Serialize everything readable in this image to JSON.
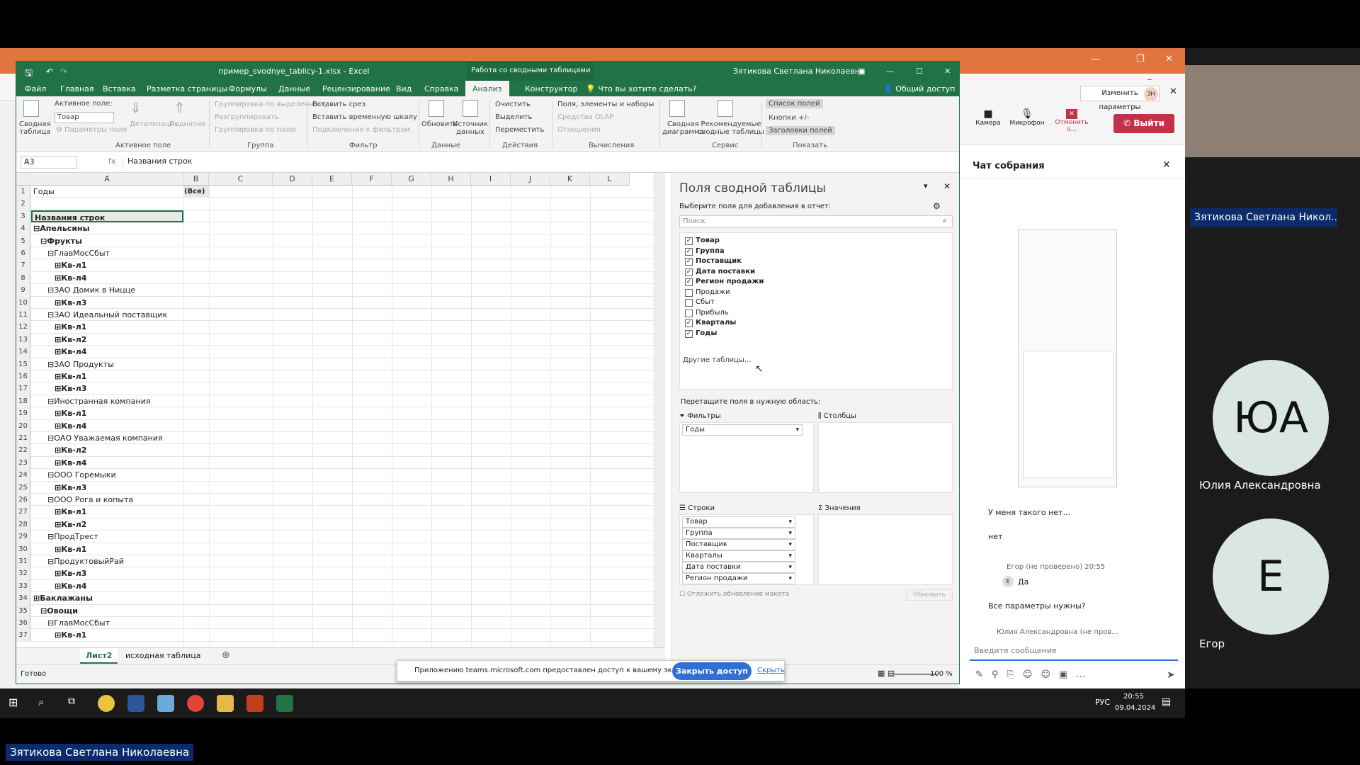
{
  "browser": {
    "share_text": "Изменить параметры"
  },
  "excel": {
    "title_file": "пример_svodnye_tablicy-1.xlsx  -  Excel",
    "title_context": "Работа со сводными таблицами",
    "title_user": "Зятикова Светлана Николаевна",
    "tabs": [
      "Файл",
      "Главная",
      "Вставка",
      "Разметка страницы",
      "Формулы",
      "Данные",
      "Рецензирование",
      "Вид",
      "Справка",
      "Анализ",
      "Конструктор"
    ],
    "tell_me": "Что вы хотите сделать?",
    "share": "Общий доступ",
    "ribbon": {
      "pivot_table": "Сводная\nтаблица",
      "active_field_label": "Активное поле:",
      "active_field_value": "Товар",
      "field_params": "Параметры поля",
      "drill_down": "Детализация",
      "drill_up": "Поднятие",
      "group_active_field": "Активное поле",
      "group_selection": "Группировка по выделенному",
      "ungroup": "Разгруппировать",
      "group_field": "Группировка по полю",
      "group_group": "Группа",
      "insert_slicer": "Вставить срез",
      "insert_timeline": "Вставить временную шкалу",
      "filter_connections": "Подключения к фильтрам",
      "group_filter": "Фильтр",
      "refresh": "Обновить",
      "data_source": "Источник\nданных",
      "group_data": "Данные",
      "clear": "Очистить",
      "select": "Выделить",
      "move": "Переместить",
      "group_actions": "Действия",
      "fields_items": "Поля, элементы и наборы",
      "olap": "Средства OLAP",
      "relations": "Отношения",
      "group_calc": "Вычисления",
      "pivot_chart": "Сводная\nдиаграмма",
      "recommended": "Рекомендуемые\nсводные таблицы",
      "group_service": "Сервис",
      "field_list": "Список полей",
      "buttons": "Кнопки +/-",
      "headers": "Заголовки полей",
      "group_show": "Показать"
    },
    "name_box": "A3",
    "formula": "Названия строк",
    "columns": [
      "A",
      "B",
      "C",
      "D",
      "E",
      "F",
      "G",
      "H",
      "I",
      "J",
      "K",
      "L"
    ],
    "rows": [
      {
        "n": "1",
        "a": "Годы",
        "b": "(Все)",
        "bold": false,
        "indent": 0
      },
      {
        "n": "2",
        "a": "",
        "bold": false,
        "indent": 0
      },
      {
        "n": "3",
        "a": "Названия строк",
        "bold": true,
        "indent": 0
      },
      {
        "n": "4",
        "a": "⊟Апельсины",
        "bold": true,
        "indent": 0
      },
      {
        "n": "5",
        "a": "⊟Фрукты",
        "bold": true,
        "indent": 1
      },
      {
        "n": "6",
        "a": "⊟ГлавМосСбыт",
        "bold": false,
        "indent": 2
      },
      {
        "n": "7",
        "a": "⊞Кв-л1",
        "bold": true,
        "indent": 3
      },
      {
        "n": "8",
        "a": "⊞Кв-л4",
        "bold": true,
        "indent": 3
      },
      {
        "n": "9",
        "a": "⊟ЗАО Домик в Ницце",
        "bold": false,
        "indent": 2
      },
      {
        "n": "10",
        "a": "⊞Кв-л3",
        "bold": true,
        "indent": 3
      },
      {
        "n": "11",
        "a": "⊟ЗАО Идеальный поставщик",
        "bold": false,
        "indent": 2
      },
      {
        "n": "12",
        "a": "⊞Кв-л1",
        "bold": true,
        "indent": 3
      },
      {
        "n": "13",
        "a": "⊞Кв-л2",
        "bold": true,
        "indent": 3
      },
      {
        "n": "14",
        "a": "⊞Кв-л4",
        "bold": true,
        "indent": 3
      },
      {
        "n": "15",
        "a": "⊟ЗАО Продукты",
        "bold": false,
        "indent": 2
      },
      {
        "n": "16",
        "a": "⊞Кв-л1",
        "bold": true,
        "indent": 3
      },
      {
        "n": "17",
        "a": "⊞Кв-л3",
        "bold": true,
        "indent": 3
      },
      {
        "n": "18",
        "a": "⊟Иностранная компания",
        "bold": false,
        "indent": 2
      },
      {
        "n": "19",
        "a": "⊞Кв-л1",
        "bold": true,
        "indent": 3
      },
      {
        "n": "20",
        "a": "⊞Кв-л4",
        "bold": true,
        "indent": 3
      },
      {
        "n": "21",
        "a": "⊟ОАО Уважаемая компания",
        "bold": false,
        "indent": 2
      },
      {
        "n": "22",
        "a": "⊞Кв-л2",
        "bold": true,
        "indent": 3
      },
      {
        "n": "23",
        "a": "⊞Кв-л4",
        "bold": true,
        "indent": 3
      },
      {
        "n": "24",
        "a": "⊟ООО Горемыки",
        "bold": false,
        "indent": 2
      },
      {
        "n": "25",
        "a": "⊞Кв-л3",
        "bold": true,
        "indent": 3
      },
      {
        "n": "26",
        "a": "⊟ООО Рога и копыта",
        "bold": false,
        "indent": 2
      },
      {
        "n": "27",
        "a": "⊞Кв-л1",
        "bold": true,
        "indent": 3
      },
      {
        "n": "28",
        "a": "⊞Кв-л2",
        "bold": true,
        "indent": 3
      },
      {
        "n": "29",
        "a": "⊟ПродТрест",
        "bold": false,
        "indent": 2
      },
      {
        "n": "30",
        "a": "⊞Кв-л1",
        "bold": true,
        "indent": 3
      },
      {
        "n": "31",
        "a": "⊟ПродуктовыйРай",
        "bold": false,
        "indent": 2
      },
      {
        "n": "32",
        "a": "⊞Кв-л3",
        "bold": true,
        "indent": 3
      },
      {
        "n": "33",
        "a": "⊞Кв-л4",
        "bold": true,
        "indent": 3
      },
      {
        "n": "34",
        "a": "⊞Баклажаны",
        "bold": true,
        "indent": 0
      },
      {
        "n": "35",
        "a": "⊟Овощи",
        "bold": true,
        "indent": 1
      },
      {
        "n": "36",
        "a": "⊟ГлавМосСбыт",
        "bold": false,
        "indent": 2
      },
      {
        "n": "37",
        "a": "⊞Кв-л1",
        "bold": true,
        "indent": 3
      }
    ],
    "sheet_tabs": [
      "Лист2",
      "исходная таблица"
    ],
    "status": "Готово",
    "zoom": "100 %",
    "pane": {
      "title": "Поля сводной таблицы",
      "choose": "Выберите поля для добавления в отчет:",
      "search_placeholder": "Поиск",
      "fields": [
        {
          "name": "Товар",
          "checked": true
        },
        {
          "name": "Группа",
          "checked": true
        },
        {
          "name": "Поставщик",
          "checked": true
        },
        {
          "name": "Дата поставки",
          "checked": true
        },
        {
          "name": "Регион продажи",
          "checked": true
        },
        {
          "name": "Продажи",
          "checked": false
        },
        {
          "name": "Сбыт",
          "checked": false
        },
        {
          "name": "Прибыль",
          "checked": false
        },
        {
          "name": "Кварталы",
          "checked": true
        },
        {
          "name": "Годы",
          "checked": true
        }
      ],
      "other_tables": "Другие таблицы...",
      "drag_hint": "Перетащите поля в нужную область:",
      "filters_label": "Фильтры",
      "filters": [
        "Годы"
      ],
      "columns_label": "Столбцы",
      "rows_label": "Строки",
      "rows": [
        "Товар",
        "Группа",
        "Поставщик",
        "Кварталы",
        "Дата поставки",
        "Регион продажи"
      ],
      "values_label": "Значения",
      "defer": "Отложить обновление макета",
      "update": "Обновить"
    }
  },
  "notice": {
    "text": "Приложению teams.microsoft.com предоставлен доступ к вашему экрану.",
    "stop": "Закрыть доступ",
    "hide": "Скрыть"
  },
  "teams": {
    "camera": "Камера",
    "mic": "Микрофон",
    "cancel": "Отменить о...",
    "leave": "Выйти",
    "chat_title": "Чат собрания",
    "msg1": "У меня такого нет...",
    "msg2": "нет",
    "egor_meta": "Егор (не проверено)  20:55",
    "egor_msg": "Да",
    "msg3": "Все параметры нужны?",
    "typing": "Юлия Александровна (не пров...",
    "input_placeholder": "Введите сообщение",
    "presenter_tag": "Зятикова Светлана Никол...",
    "p1_initials": "ЮА",
    "p1_name": "Юлия Александровна",
    "p2_initials": "Е",
    "p2_name": "Егор",
    "avatar_small": "ЗН"
  },
  "taskbar": {
    "lang": "РУС",
    "time": "20:55",
    "date": "09.04.2024"
  },
  "bottom_name": "Зятикова Светлана Николаевна",
  "colors": {
    "excel_green": "#217346",
    "teams_leave": "#c4314b",
    "teams_blue": "#2f6fd6",
    "browser_orange": "#e2753e"
  }
}
